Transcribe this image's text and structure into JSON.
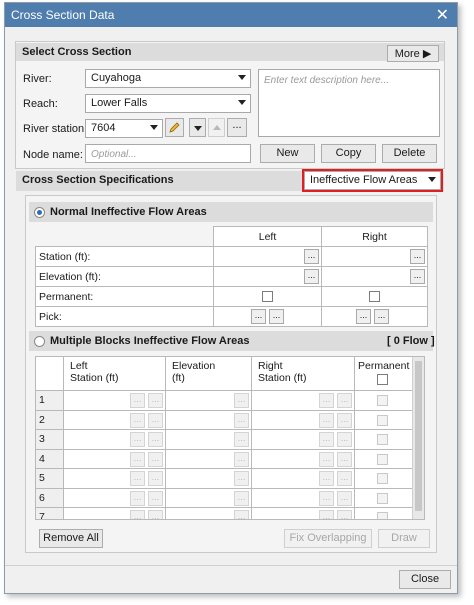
{
  "window": {
    "title": "Cross Section Data",
    "close_glyph": "✕"
  },
  "select_section": {
    "header": "Select Cross Section",
    "more_label": "More",
    "river_label": "River:",
    "river_value": "Cuyahoga",
    "reach_label": "Reach:",
    "reach_value": "Lower Falls",
    "station_label": "River station:",
    "station_value": "7604",
    "node_label": "Node name:",
    "node_placeholder": "Optional...",
    "description_placeholder": "Enter text description here...",
    "new_label": "New",
    "copy_label": "Copy",
    "delete_label": "Delete",
    "ellipsis": "...",
    "highlight_color": "#e02020"
  },
  "specs": {
    "header": "Cross Section Specifications",
    "selected_spec": "Ineffective Flow Areas"
  },
  "normal": {
    "title": "Normal Ineffective Flow Areas",
    "col_left": "Left",
    "col_right": "Right",
    "rows": [
      "Station (ft):",
      "Elevation (ft):",
      "Permanent:",
      "Pick:"
    ],
    "dots": "..."
  },
  "blocks": {
    "title": "Multiple Blocks Ineffective Flow Areas",
    "flow_count": "[ 0 Flow ]",
    "col_left": "Left\nStation (ft)",
    "col_elev": "Elevation\n(ft)",
    "col_right": "Right\nStation (ft)",
    "col_perm": "Permanent",
    "row_numbers": [
      "1",
      "2",
      "3",
      "4",
      "5",
      "6",
      "7"
    ],
    "dots": "..."
  },
  "actions": {
    "remove_all": "Remove All",
    "fix_overlapping": "Fix Overlapping",
    "draw": "Draw",
    "close": "Close"
  }
}
